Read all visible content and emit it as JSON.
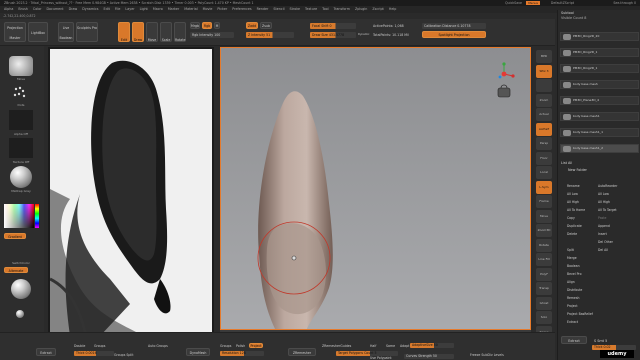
{
  "titlebar": {
    "app": "ZBrush 2023.2",
    "file": "Tribal_Princess_without_??",
    "stats": "Free Mem 0.984GB • Active Mem 2638 • Scratch Disk 1339 • Timer 0.003 • PolyCount 1.470 KP • MeshCount 1",
    "quicksave": "QuickSave",
    "seethrough": "See-through 0",
    "menus": "Menus",
    "defaultscript": "DefaultZScript"
  },
  "menubar": {
    "items": [
      "Alpha",
      "Brush",
      "Color",
      "Document",
      "Draw",
      "Dynamics",
      "Edit",
      "File",
      "Layer",
      "Light",
      "Macro",
      "Marker",
      "Material",
      "Movie",
      "Picker",
      "Preferences",
      "Render",
      "Stencil",
      "Stroke",
      "Texture",
      "Tool",
      "Transform",
      "Zplugin",
      "Zscript",
      "Help"
    ]
  },
  "statusline": "-2.742,22.400,0.872",
  "topshelf": {
    "projection_master": "Projection Master",
    "lightbox": "LightBox",
    "live_boolean": "Live Boolean",
    "sculptris": "Sculptris Pro",
    "edit": "Edit",
    "draw": "Draw",
    "move": "Move",
    "scale": "Scale",
    "rotate": "Rotate",
    "mrgb": "Mrgb",
    "rgb": "Rgb",
    "m": "M",
    "rgb_intensity": "Rgb Intensity 100",
    "zadd": "Zadd",
    "zsub": "Zsub",
    "z_intensity": "Z Intensity 51",
    "focal_shift": "Focal Shift 0",
    "draw_size": "Draw Size 431.5778",
    "dynamic": "Dynamic",
    "active_points": "ActivePoints: 1,068",
    "total_points": "TotalPoints: 10.118 Mil",
    "calibration": "Calibration Distance 0.10778",
    "spotlight": "Spotlight Projection"
  },
  "leftbar": {
    "move": "Move",
    "dots": "Dots",
    "alpha_off": "Alpha Off",
    "texture_off": "Texture Off",
    "material": "MatCap Gray",
    "gradient": "Gradient",
    "switch_color": "SwitchColor",
    "alternate": "Alternate",
    "base_material": "BasicMaterial"
  },
  "rightbar": {
    "buttons": [
      "BPR",
      "SPix 3",
      "",
      "Zoom",
      "Actual",
      "AAHalf",
      "Persp",
      "Floor",
      "Local",
      "L.Sym",
      "Frame",
      "Move",
      "Zoom3D",
      "Rotate",
      "Line Fill",
      "PolyF",
      "Transp",
      "Ghost",
      "Solo",
      "Xpose"
    ],
    "dynamic": "Dynamic",
    "solo": "Solo"
  },
  "subtool": {
    "title": "Subtool",
    "visible_count": "Visible Count 8",
    "items": [
      "PM3D_Ring2D_20",
      "PM3D_Ring2D_1",
      "PM3D_Ring2D_1",
      "body base mesh",
      "PM3D_Plane3D_4",
      "body base mesh1",
      "body base mesh1_1",
      "body base mesh1_2"
    ],
    "list_all": "List All",
    "new_folder": "New Folder",
    "menu_left": [
      "Rename",
      "All Low",
      "All High",
      "All To Home",
      "Copy",
      "Duplicate",
      "Delete",
      "",
      "Split",
      "Merge",
      "Boolean",
      "Bevel Pro",
      "Align",
      "Distribute",
      "Remesh",
      "Project",
      "Project BasRelief",
      "Extract"
    ],
    "menu_right": [
      "AutoReorder",
      "All Low",
      "All High",
      "All To Target",
      "Paste",
      "Append",
      "Insert",
      "Del Other",
      "Del All"
    ],
    "extract_btn": "Extract",
    "s_smt": "S Smt 5",
    "thick": "Thick 0.02"
  },
  "viewport": {
    "mirror": "Mirror And Weld",
    "backface": "BackfaceMask",
    "close_holes": "Close Holes",
    "del_hidden": "Del Hidden",
    "inflate": "Inflate",
    "size": "Size"
  },
  "bottombar": {
    "extract": "Extract",
    "double": "Double",
    "groups": "Groups",
    "thick": "Thick 0.0016",
    "groups_split": "Groups Split",
    "auto_groups": "Auto Groups",
    "dynamesh": "DynaMesh",
    "groups_btn": "Groups",
    "polish": "Polish",
    "project": "Project",
    "resolution": "Resolution 128",
    "zremesher": "ZRemesher",
    "zremesher_guides": "ZRemesherGuides",
    "half": "Half",
    "same": "Same",
    "adapt": "Adapt",
    "adaptive_size": "AdaptiveSize 50",
    "target_polygons": "Target Polygons Count 5",
    "use_polypaint": "Use Polypaint",
    "curves_strength": "Curves Strength 50",
    "freeze_subdiv": "Freeze SubDiv Levels",
    "udemy": "udemy"
  }
}
